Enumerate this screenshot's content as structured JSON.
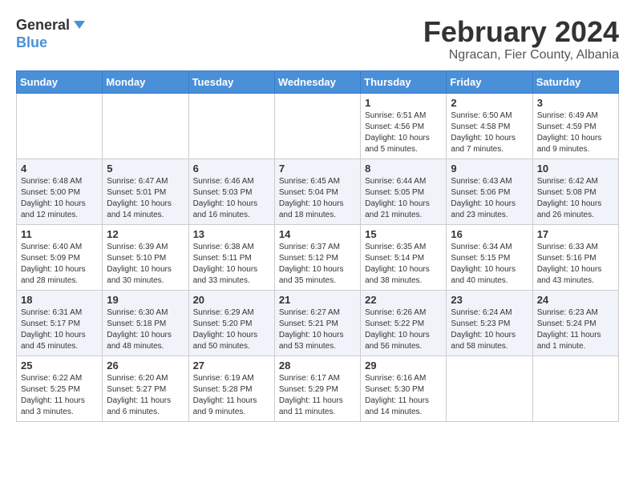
{
  "logo": {
    "general": "General",
    "blue": "Blue"
  },
  "title": "February 2024",
  "subtitle": "Ngracan, Fier County, Albania",
  "calendar": {
    "headers": [
      "Sunday",
      "Monday",
      "Tuesday",
      "Wednesday",
      "Thursday",
      "Friday",
      "Saturday"
    ],
    "weeks": [
      [
        {
          "day": "",
          "info": ""
        },
        {
          "day": "",
          "info": ""
        },
        {
          "day": "",
          "info": ""
        },
        {
          "day": "",
          "info": ""
        },
        {
          "day": "1",
          "info": "Sunrise: 6:51 AM\nSunset: 4:56 PM\nDaylight: 10 hours\nand 5 minutes."
        },
        {
          "day": "2",
          "info": "Sunrise: 6:50 AM\nSunset: 4:58 PM\nDaylight: 10 hours\nand 7 minutes."
        },
        {
          "day": "3",
          "info": "Sunrise: 6:49 AM\nSunset: 4:59 PM\nDaylight: 10 hours\nand 9 minutes."
        }
      ],
      [
        {
          "day": "4",
          "info": "Sunrise: 6:48 AM\nSunset: 5:00 PM\nDaylight: 10 hours\nand 12 minutes."
        },
        {
          "day": "5",
          "info": "Sunrise: 6:47 AM\nSunset: 5:01 PM\nDaylight: 10 hours\nand 14 minutes."
        },
        {
          "day": "6",
          "info": "Sunrise: 6:46 AM\nSunset: 5:03 PM\nDaylight: 10 hours\nand 16 minutes."
        },
        {
          "day": "7",
          "info": "Sunrise: 6:45 AM\nSunset: 5:04 PM\nDaylight: 10 hours\nand 18 minutes."
        },
        {
          "day": "8",
          "info": "Sunrise: 6:44 AM\nSunset: 5:05 PM\nDaylight: 10 hours\nand 21 minutes."
        },
        {
          "day": "9",
          "info": "Sunrise: 6:43 AM\nSunset: 5:06 PM\nDaylight: 10 hours\nand 23 minutes."
        },
        {
          "day": "10",
          "info": "Sunrise: 6:42 AM\nSunset: 5:08 PM\nDaylight: 10 hours\nand 26 minutes."
        }
      ],
      [
        {
          "day": "11",
          "info": "Sunrise: 6:40 AM\nSunset: 5:09 PM\nDaylight: 10 hours\nand 28 minutes."
        },
        {
          "day": "12",
          "info": "Sunrise: 6:39 AM\nSunset: 5:10 PM\nDaylight: 10 hours\nand 30 minutes."
        },
        {
          "day": "13",
          "info": "Sunrise: 6:38 AM\nSunset: 5:11 PM\nDaylight: 10 hours\nand 33 minutes."
        },
        {
          "day": "14",
          "info": "Sunrise: 6:37 AM\nSunset: 5:12 PM\nDaylight: 10 hours\nand 35 minutes."
        },
        {
          "day": "15",
          "info": "Sunrise: 6:35 AM\nSunset: 5:14 PM\nDaylight: 10 hours\nand 38 minutes."
        },
        {
          "day": "16",
          "info": "Sunrise: 6:34 AM\nSunset: 5:15 PM\nDaylight: 10 hours\nand 40 minutes."
        },
        {
          "day": "17",
          "info": "Sunrise: 6:33 AM\nSunset: 5:16 PM\nDaylight: 10 hours\nand 43 minutes."
        }
      ],
      [
        {
          "day": "18",
          "info": "Sunrise: 6:31 AM\nSunset: 5:17 PM\nDaylight: 10 hours\nand 45 minutes."
        },
        {
          "day": "19",
          "info": "Sunrise: 6:30 AM\nSunset: 5:18 PM\nDaylight: 10 hours\nand 48 minutes."
        },
        {
          "day": "20",
          "info": "Sunrise: 6:29 AM\nSunset: 5:20 PM\nDaylight: 10 hours\nand 50 minutes."
        },
        {
          "day": "21",
          "info": "Sunrise: 6:27 AM\nSunset: 5:21 PM\nDaylight: 10 hours\nand 53 minutes."
        },
        {
          "day": "22",
          "info": "Sunrise: 6:26 AM\nSunset: 5:22 PM\nDaylight: 10 hours\nand 56 minutes."
        },
        {
          "day": "23",
          "info": "Sunrise: 6:24 AM\nSunset: 5:23 PM\nDaylight: 10 hours\nand 58 minutes."
        },
        {
          "day": "24",
          "info": "Sunrise: 6:23 AM\nSunset: 5:24 PM\nDaylight: 11 hours\nand 1 minute."
        }
      ],
      [
        {
          "day": "25",
          "info": "Sunrise: 6:22 AM\nSunset: 5:25 PM\nDaylight: 11 hours\nand 3 minutes."
        },
        {
          "day": "26",
          "info": "Sunrise: 6:20 AM\nSunset: 5:27 PM\nDaylight: 11 hours\nand 6 minutes."
        },
        {
          "day": "27",
          "info": "Sunrise: 6:19 AM\nSunset: 5:28 PM\nDaylight: 11 hours\nand 9 minutes."
        },
        {
          "day": "28",
          "info": "Sunrise: 6:17 AM\nSunset: 5:29 PM\nDaylight: 11 hours\nand 11 minutes."
        },
        {
          "day": "29",
          "info": "Sunrise: 6:16 AM\nSunset: 5:30 PM\nDaylight: 11 hours\nand 14 minutes."
        },
        {
          "day": "",
          "info": ""
        },
        {
          "day": "",
          "info": ""
        }
      ]
    ]
  }
}
